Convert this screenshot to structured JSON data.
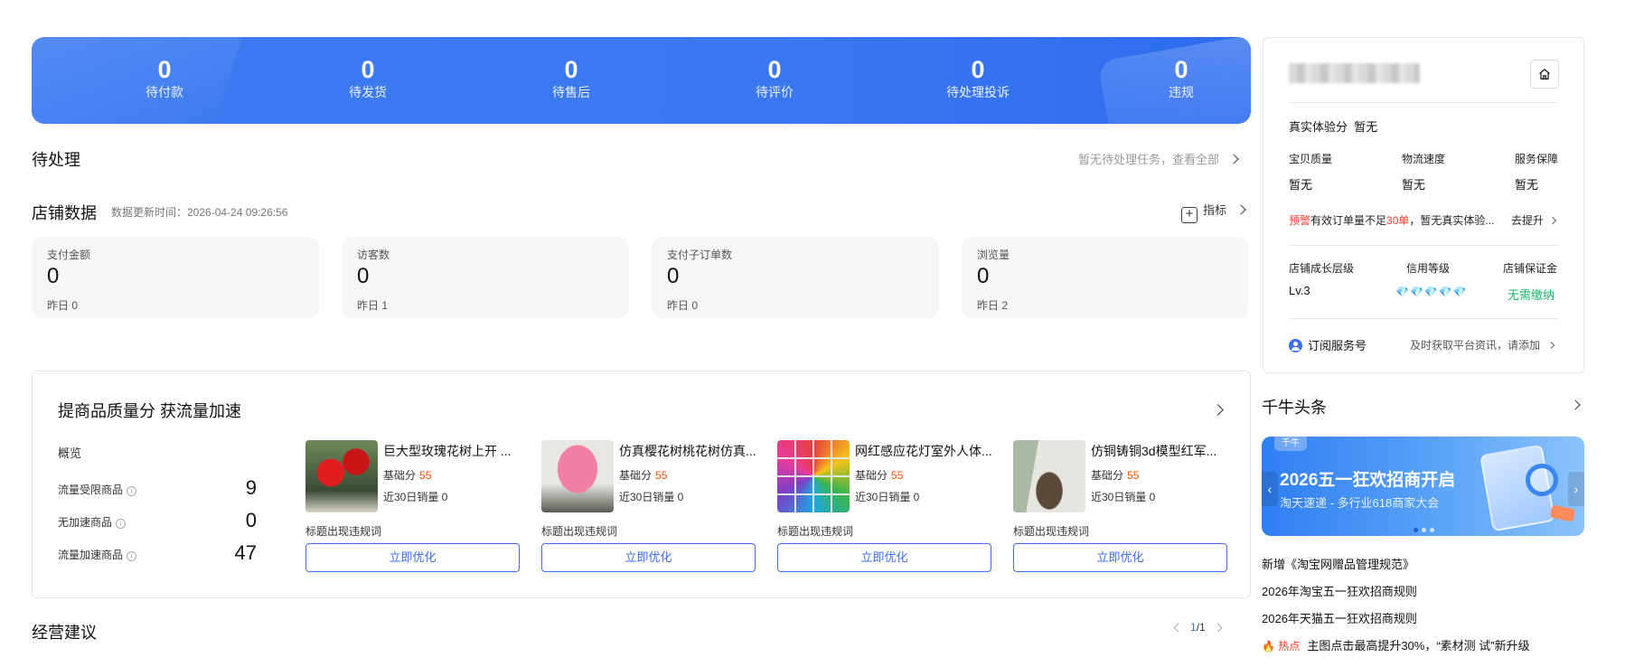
{
  "banner": {
    "stats": [
      {
        "value": "0",
        "label": "待付款"
      },
      {
        "value": "0",
        "label": "待发货"
      },
      {
        "value": "0",
        "label": "待售后"
      },
      {
        "value": "0",
        "label": "待评价"
      },
      {
        "value": "0",
        "label": "待处理投诉"
      },
      {
        "value": "0",
        "label": "违规"
      }
    ]
  },
  "pending": {
    "title": "待处理",
    "link": "暂无待处理任务，查看全部"
  },
  "store_data": {
    "title": "店铺数据",
    "update_time": "数据更新时间：2026-04-24 09:26:56",
    "metrics_label": "指标",
    "cards": [
      {
        "label": "支付金额",
        "value": "0",
        "yesterday": "昨日 0"
      },
      {
        "label": "访客数",
        "value": "0",
        "yesterday": "昨日 1"
      },
      {
        "label": "支付子订单数",
        "value": "0",
        "yesterday": "昨日 0"
      },
      {
        "label": "浏览量",
        "value": "0",
        "yesterday": "昨日 2"
      }
    ]
  },
  "quality": {
    "title": "提商品质量分 获流量加速",
    "overview_title": "概览",
    "overview": [
      {
        "label": "流量受限商品",
        "value": "9"
      },
      {
        "label": "无加速商品",
        "value": "0"
      },
      {
        "label": "流量加速商品",
        "value": "47"
      }
    ],
    "products": [
      {
        "name": "巨大型玫瑰花树上开 ...",
        "score_label": "基础分",
        "score": "55",
        "sales": "近30日销量 0",
        "warning": "标题出现违规词",
        "button": "立即优化"
      },
      {
        "name": "仿真樱花树桃花树仿真...",
        "score_label": "基础分",
        "score": "55",
        "sales": "近30日销量 0",
        "warning": "标题出现违规词",
        "button": "立即优化"
      },
      {
        "name": "网红感应花灯室外人体...",
        "score_label": "基础分",
        "score": "55",
        "sales": "近30日销量 0",
        "warning": "标题出现违规词",
        "button": "立即优化"
      },
      {
        "name": "仿铜铸铜3d模型红军...",
        "score_label": "基础分",
        "score": "55",
        "sales": "近30日销量 0",
        "warning": "标题出现违规词",
        "button": "立即优化"
      }
    ]
  },
  "advice": {
    "title": "经营建议",
    "page_current": "1",
    "page_sep": "/",
    "page_total": "1"
  },
  "store_panel": {
    "experience_label": "真实体验分",
    "experience_value": "暂无",
    "sub_scores": [
      {
        "label": "宝贝质量",
        "value": "暂无"
      },
      {
        "label": "物流速度",
        "value": "暂无"
      },
      {
        "label": "服务保障",
        "value": "暂无"
      }
    ],
    "warn_tag": "预警",
    "warn_text_1": "有效订单量不足",
    "warn_num": "30单",
    "warn_text_2": "，暂无真实体验...",
    "improve_link": "去提升",
    "growth_label": "店铺成长层级",
    "growth_value": "Lv.3",
    "credit_label": "信用等级",
    "credit_diamonds": "💎💎💎💎💎",
    "deposit_label": "店铺保证金",
    "deposit_value": "无需缴纳",
    "subscribe_label": "订阅服务号",
    "subscribe_link": "及时获取平台资讯，请添加"
  },
  "news": {
    "title": "千牛头条",
    "banner_tag": "千牛",
    "banner_headline": "2026五一狂欢招商开启",
    "banner_sub": "淘天速递 - 多行业618商家大会",
    "items": [
      "新增《淘宝网赠品管理规范》",
      "2026年淘宝五一狂欢招商规则",
      "2026年天猫五一狂欢招商规则"
    ],
    "hot_tag": "热点",
    "hot_item": "主图点击最高提升30%，“素材测 试”新升级"
  },
  "colors": {
    "accent": "#3d6ef0",
    "banner": "#3b78f0",
    "score": "#ff5000",
    "warn": "#ff3b30",
    "deposit": "#18b46b"
  }
}
